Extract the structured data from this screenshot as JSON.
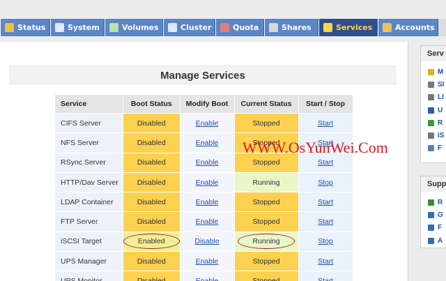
{
  "tabs": [
    {
      "label": "Status",
      "icon": "status-icon",
      "color": "#f0c040",
      "active": false
    },
    {
      "label": "System",
      "icon": "monitor-icon",
      "color": "#dfe9f7",
      "active": false
    },
    {
      "label": "Volumes",
      "icon": "volumes-icon",
      "color": "#bfe3a6",
      "active": false
    },
    {
      "label": "Cluster",
      "icon": "cluster-icon",
      "color": "#dfe9f7",
      "active": false
    },
    {
      "label": "Quota",
      "icon": "quota-icon",
      "color": "#e57c7c",
      "active": false
    },
    {
      "label": "Shares",
      "icon": "shares-icon",
      "color": "#d8d8d8",
      "active": false
    },
    {
      "label": "Services",
      "icon": "lightning-icon",
      "color": "#ffd24a",
      "active": true
    },
    {
      "label": "Accounts",
      "icon": "accounts-icon",
      "color": "#f3c060",
      "active": false
    }
  ],
  "page": {
    "title": "Manage Services"
  },
  "table": {
    "headers": [
      "Service",
      "Boot Status",
      "Modify Boot",
      "Current Status",
      "Start / Stop"
    ],
    "rows": [
      {
        "service": "CIFS Server",
        "boot": "Disabled",
        "modify": "Enable",
        "current": "Stopped",
        "action": "Start"
      },
      {
        "service": "NFS Server",
        "boot": "Disabled",
        "modify": "Enable",
        "current": "Stopped",
        "action": "Start"
      },
      {
        "service": "RSync Server",
        "boot": "Disabled",
        "modify": "Enable",
        "current": "Stopped",
        "action": "Start"
      },
      {
        "service": "HTTP/Dav Server",
        "boot": "Disabled",
        "modify": "Enable",
        "current": "Running",
        "action": "Stop"
      },
      {
        "service": "LDAP Container",
        "boot": "Disabled",
        "modify": "Enable",
        "current": "Stopped",
        "action": "Start"
      },
      {
        "service": "FTP Server",
        "boot": "Disabled",
        "modify": "Enable",
        "current": "Stopped",
        "action": "Start"
      },
      {
        "service": "iSCSI Target",
        "boot": "Enabled",
        "modify": "Disable",
        "current": "Running",
        "action": "Stop",
        "highlight": true
      },
      {
        "service": "UPS Manager",
        "boot": "Disabled",
        "modify": "Enable",
        "current": "Stopped",
        "action": "Start"
      },
      {
        "service": "UPS Monitor",
        "boot": "Disabled",
        "modify": "Enable",
        "current": "Stopped",
        "action": "Start"
      }
    ]
  },
  "watermark": "WWW.OsYunWei.Com",
  "sidebar": {
    "services": {
      "title": "Serv",
      "items": [
        {
          "label": "M",
          "icon": "manage-icon",
          "color": "#e0b020"
        },
        {
          "label": "SI",
          "icon": "drive-icon",
          "color": "#777777"
        },
        {
          "label": "LI",
          "icon": "drive-icon",
          "color": "#777777"
        },
        {
          "label": "U",
          "icon": "ups-icon",
          "color": "#2a5db0"
        },
        {
          "label": "R",
          "icon": "rsync-icon",
          "color": "#3a9a3a"
        },
        {
          "label": "iS",
          "icon": "iscsi-icon",
          "color": "#777777"
        },
        {
          "label": "F",
          "icon": "ftp-icon",
          "color": "#5a7fbf"
        }
      ]
    },
    "support": {
      "title": "Supp",
      "items": [
        {
          "label": "R",
          "icon": "leaf-icon",
          "color": "#3a8a3a"
        },
        {
          "label": "G",
          "icon": "guide-icon",
          "color": "#2f6fb5"
        },
        {
          "label": "F",
          "icon": "forum-icon",
          "color": "#2f6fb5"
        },
        {
          "label": "A",
          "icon": "about-icon",
          "color": "#2f6fb5"
        }
      ]
    }
  }
}
